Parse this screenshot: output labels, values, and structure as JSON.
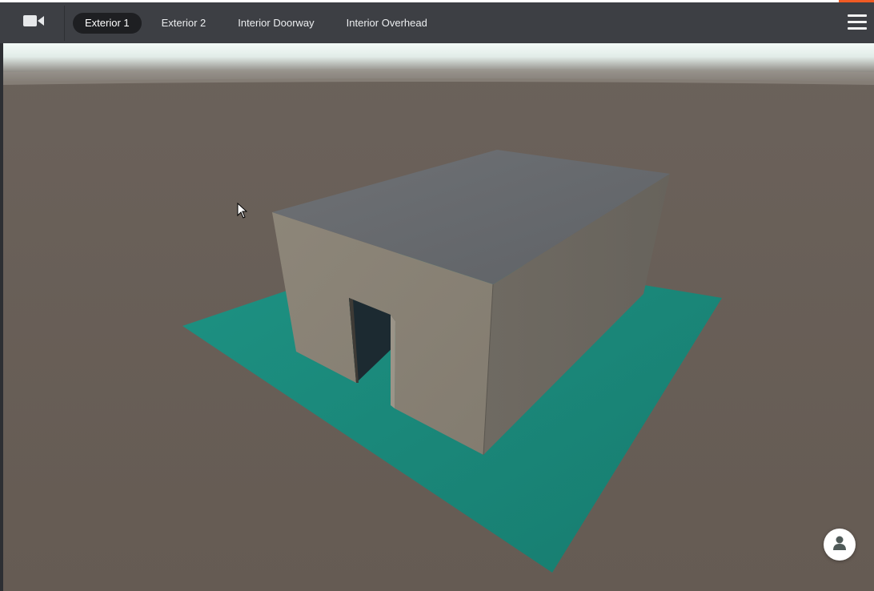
{
  "toolbar": {
    "camera_icon": "video-camera-icon",
    "menu_icon": "hamburger-menu-icon",
    "tabs": [
      {
        "label": "Exterior 1",
        "active": true
      },
      {
        "label": "Exterior 2",
        "active": false
      },
      {
        "label": "Interior Doorway",
        "active": false
      },
      {
        "label": "Interior Overhead",
        "active": false
      }
    ]
  },
  "viewport": {
    "scene": "3d-building-model",
    "colors": {
      "sky": "#eaf3f1",
      "ground": "#665c55",
      "slab": "#1c8a7c",
      "roof": "#66696d",
      "wall_front": "#8a8378",
      "wall_side": "#6d6860",
      "doorway": "#1d2a30"
    }
  },
  "avatar_button": {
    "icon": "user-icon"
  },
  "colors": {
    "toolbar_bg": "#3d3f44",
    "active_tab_bg": "#1e1f22",
    "accent": "#f05a24"
  }
}
